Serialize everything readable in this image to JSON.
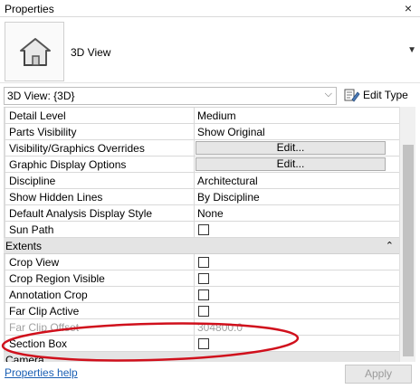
{
  "window": {
    "title": "Properties",
    "close_glyph": "×"
  },
  "type_header": {
    "name": "3D View",
    "icon": "house-icon",
    "dropdown_icon": "dropdown-arrow-icon"
  },
  "selector": {
    "value": "3D View: {3D}",
    "chevron_icon": "chevron-down-icon"
  },
  "edit_type": {
    "label": "Edit Type",
    "icon": "edit-type-icon"
  },
  "rows": [
    {
      "kind": "prop",
      "name": "Detail Level",
      "value": "Medium"
    },
    {
      "kind": "prop",
      "name": "Parts Visibility",
      "value": "Show Original"
    },
    {
      "kind": "button",
      "name": "Visibility/Graphics Overrides",
      "value": "Edit..."
    },
    {
      "kind": "button",
      "name": "Graphic Display Options",
      "value": "Edit..."
    },
    {
      "kind": "prop",
      "name": "Discipline",
      "value": "Architectural"
    },
    {
      "kind": "prop",
      "name": "Show Hidden Lines",
      "value": "By Discipline"
    },
    {
      "kind": "prop",
      "name": "Default Analysis Display Style",
      "value": "None"
    },
    {
      "kind": "check",
      "name": "Sun Path",
      "checked": false
    },
    {
      "kind": "group",
      "name": "Extents",
      "collapse_glyph": "⌃"
    },
    {
      "kind": "check",
      "name": "Crop View",
      "checked": false
    },
    {
      "kind": "check",
      "name": "Crop Region Visible",
      "checked": false
    },
    {
      "kind": "check",
      "name": "Annotation Crop",
      "checked": false
    },
    {
      "kind": "check",
      "name": "Far Clip Active",
      "checked": false
    },
    {
      "kind": "disabled",
      "name": "Far Clip Offset",
      "value": "304800.0"
    },
    {
      "kind": "check",
      "name": "Section Box",
      "checked": false
    },
    {
      "kind": "group",
      "name": "Camera",
      "collapse_glyph": "⌃"
    }
  ],
  "footer": {
    "help_link": "Properties help",
    "apply_label": "Apply"
  },
  "annotation": {
    "shape": "ellipse",
    "color": "#d0101c",
    "target": "Section Box"
  },
  "colors": {
    "group_bg": "#e4e4e4",
    "link": "#1a5fb4",
    "annotation": "#d0101c"
  }
}
